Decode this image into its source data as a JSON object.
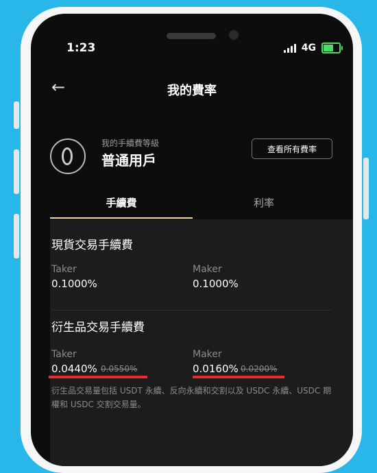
{
  "status_bar": {
    "time": "1:23",
    "network": "4G"
  },
  "header": {
    "title": "我的費率"
  },
  "level": {
    "label": "我的手續費等級",
    "name": "普通用戶"
  },
  "view_all_button": "查看所有費率",
  "tabs": [
    {
      "label": "手續費",
      "active": true
    },
    {
      "label": "利率",
      "active": false
    }
  ],
  "spot": {
    "title": "現貨交易手續費",
    "taker": {
      "label": "Taker",
      "value": "0.1000%"
    },
    "maker": {
      "label": "Maker",
      "value": "0.1000%"
    }
  },
  "derivatives": {
    "title": "衍生品交易手續費",
    "taker": {
      "label": "Taker",
      "value": "0.0440%",
      "old": "0.0550%"
    },
    "maker": {
      "label": "Maker",
      "value": "0.0160%",
      "old": "0.0200%"
    },
    "note": "衍生品交易量包括 USDT 永續、反向永續和交割以及 USDC 永續、USDC 期權和 USDC 交割交易量。"
  },
  "colors": {
    "accent_underline": "#f0d8a8",
    "highlight_red": "#e82a35",
    "background_blue": "#29b6e8"
  }
}
